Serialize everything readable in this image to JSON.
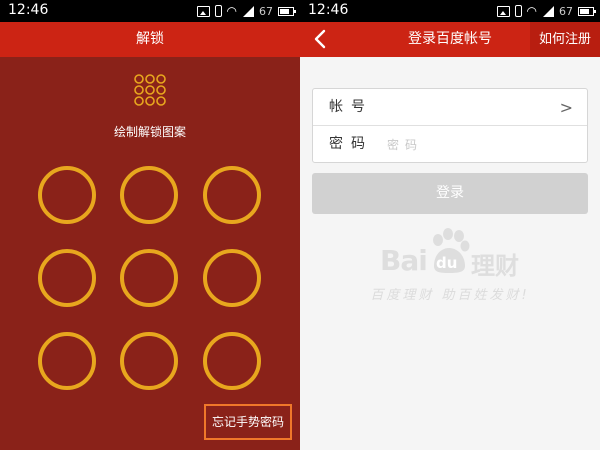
{
  "left": {
    "status_bar": {
      "time": "12:46",
      "battery": "67"
    },
    "title": "解锁",
    "hint": "绘制解锁图案",
    "pattern_dots": 9,
    "forgot_label": "忘记手势密码",
    "colors": {
      "background": "#8a2219",
      "titlebar": "#cc2414",
      "ring": "#e8a71e",
      "highlight": "#f0782a"
    }
  },
  "right": {
    "status_bar": {
      "time": "12:46",
      "battery": "67"
    },
    "title": "登录百度帐号",
    "register_label": "如何注册",
    "account_label": "帐号",
    "password_label": "密码",
    "password_placeholder": "密码",
    "login_label": "登录",
    "logo": {
      "bai": "Bai",
      "du": "du",
      "licai": "理财"
    },
    "slogan": "百度理财  助百姓发财!"
  }
}
